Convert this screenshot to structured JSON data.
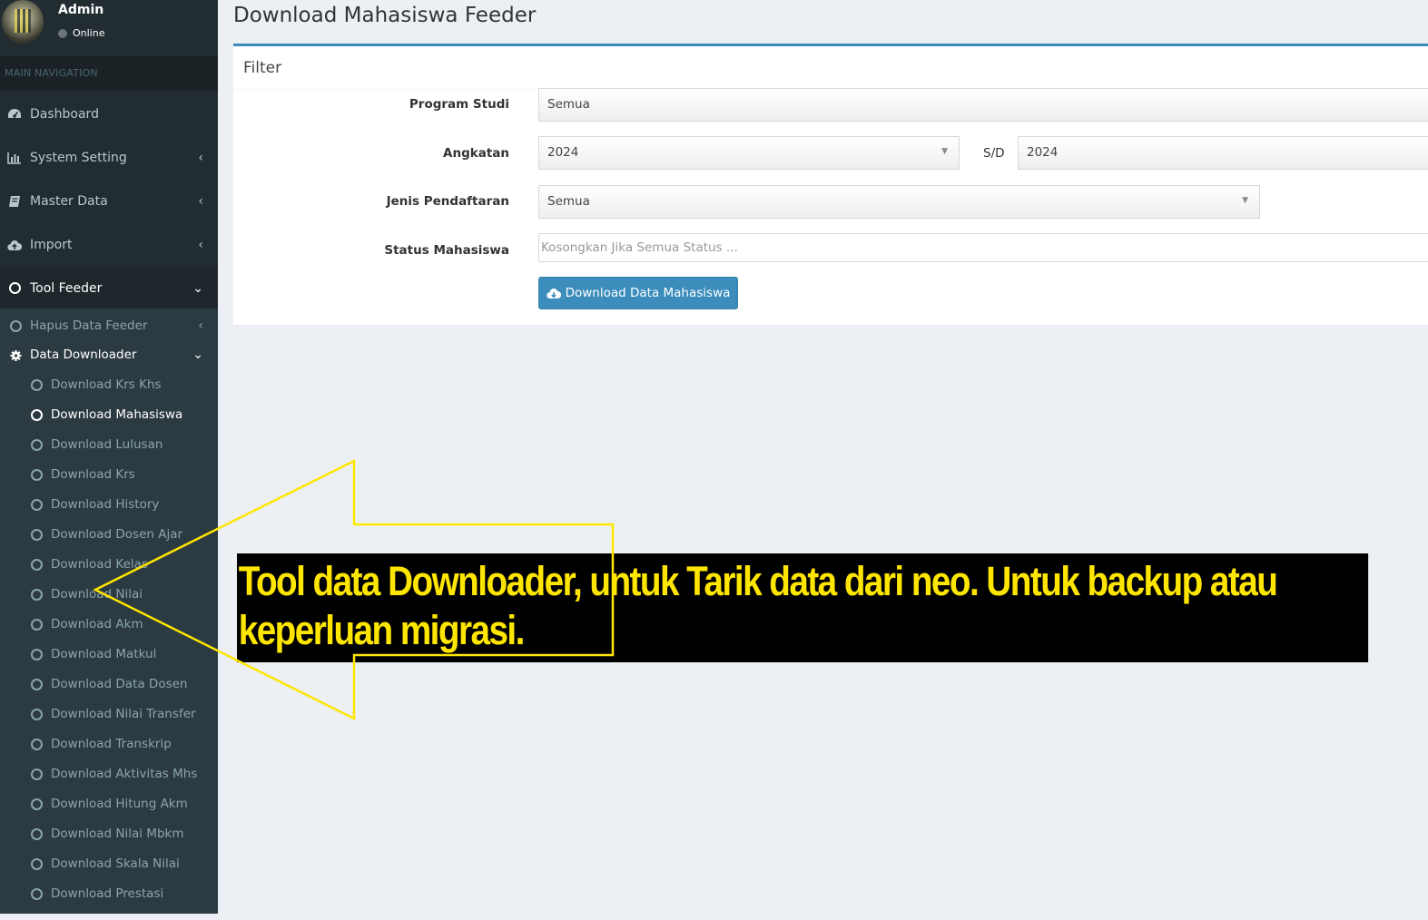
{
  "user": {
    "name": "Admin",
    "status": "Online"
  },
  "sidebar": {
    "nav_header": "MAIN NAVIGATION",
    "items": [
      {
        "label": "Dashboard",
        "icon": "dashboard-icon"
      },
      {
        "label": "System Setting",
        "icon": "bar-chart-icon"
      },
      {
        "label": "Master Data",
        "icon": "book-icon"
      },
      {
        "label": "Import",
        "icon": "cloud-upload-icon"
      },
      {
        "label": "Tool Feeder",
        "icon": "circle-icon"
      }
    ],
    "tool_feeder": {
      "hapus": "Hapus Data Feeder",
      "downloader": "Data Downloader",
      "downloads": [
        "Download Krs Khs",
        "Download Mahasiswa",
        "Download Lulusan",
        "Download Krs",
        "Download History",
        "Download Dosen Ajar",
        "Download Kelas",
        "Download Nilai",
        "Download Akm",
        "Download Matkul",
        "Download Data Dosen",
        "Download Nilai Transfer",
        "Download Transkrip",
        "Download Aktivitas Mhs",
        "Download Hitung Akm",
        "Download Nilai Mbkm",
        "Download Skala Nilai",
        "Download Prestasi"
      ]
    }
  },
  "page": {
    "title": "Download Mahasiswa Feeder"
  },
  "filter": {
    "title": "Filter",
    "program_studi": {
      "label": "Program Studi",
      "value": "Semua"
    },
    "angkatan": {
      "label": "Angkatan",
      "from": "2024",
      "separator": "S/D",
      "to": "2024"
    },
    "jenis_pendaftaran": {
      "label": "Jenis Pendaftaran",
      "value": "Semua"
    },
    "status_mahasiswa": {
      "label": "Status Mahasiswa",
      "placeholder": "Kosongkan Jika Semua Status ..."
    },
    "button": "Download Data Mahasiswa"
  },
  "annotation": {
    "text": "Tool data Downloader, untuk Tarik data dari neo. Untuk backup atau keperluan migrasi.",
    "color": "#ffe600"
  },
  "colors": {
    "sidebar": "#222d32",
    "primary": "#3c8dbc",
    "background": "#ecf0f5"
  }
}
